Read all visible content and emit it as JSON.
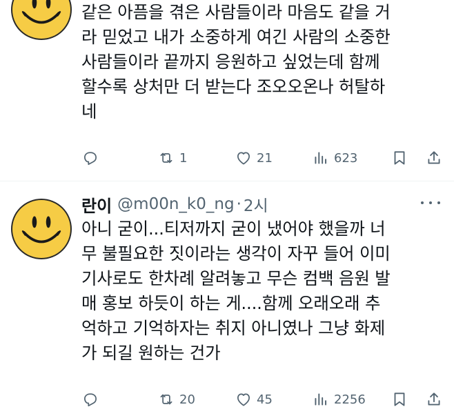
{
  "tweets": [
    {
      "text_lines": [
        "같은 아픔을 겪은 사람들이라 마음도 같을 거",
        "라 믿었고 내가 소중하게 여긴 사람의 소중한",
        "사람들이라 끝까지 응원하고 싶었는데 함께",
        "할수록 상처만 더 받는다 조오오온나 허탈하",
        "네"
      ],
      "retweets": "1",
      "likes": "21",
      "views": "623"
    },
    {
      "name": "란이",
      "handle": "@m00n_k0_ng",
      "separator": "·",
      "time": "2시",
      "text_lines": [
        "아니 굳이...티저까지 굳이 냈어야 했을까 너",
        "무 불필요한 짓이라는 생각이 자꾸 들어 이미",
        "기사로도 한차례 알려놓고 무슨 컴백 음원 발",
        "매 홍보 하듯이 하는 게....함께 오래오래 추",
        "억하고 기억하자는 취지 아니였나 그냥 화제",
        "가 되길 원하는 건가"
      ],
      "retweets": "20",
      "likes": "45",
      "views": "2256"
    }
  ],
  "icons": {
    "avatar": "smiley-face-icon",
    "reply": "reply-icon",
    "retweet": "retweet-icon",
    "like": "heart-icon",
    "views": "views-icon",
    "bookmark": "bookmark-icon",
    "share": "share-icon",
    "more": "more-icon"
  },
  "colors": {
    "text": "#0f1419",
    "secondary": "#536471",
    "avatar_yellow": "#f6cc45",
    "divider": "#eff3f4"
  }
}
